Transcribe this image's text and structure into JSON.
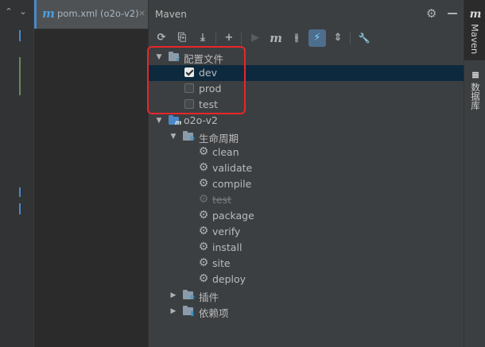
{
  "gutter": {
    "chevron_up": "⌃",
    "chevron_down": "⌄"
  },
  "editor": {
    "tab": {
      "label": "pom.xml (o2o-v2)",
      "icon": "maven-file-icon",
      "close": "×"
    }
  },
  "panel": {
    "title": "Maven"
  },
  "toolbar": [
    {
      "name": "reload-icon",
      "glyph": "⟳"
    },
    {
      "name": "folder-generate-icon",
      "glyph": "⎘"
    },
    {
      "name": "download-icon",
      "glyph": "⤓"
    },
    {
      "name": "add-icon",
      "glyph": "+"
    },
    {
      "name": "run-icon",
      "glyph": "▶"
    },
    {
      "name": "maven-goal-icon",
      "glyph": "m"
    },
    {
      "name": "toggle-offline-icon",
      "glyph": "⫲"
    },
    {
      "name": "skip-tests-icon",
      "glyph": "⚡"
    },
    {
      "name": "collapse-all-icon",
      "glyph": "⇕"
    },
    {
      "name": "settings-wrench-icon",
      "glyph": "🔧"
    }
  ],
  "tree": {
    "profiles": {
      "label": "配置文件",
      "items": [
        {
          "label": "dev",
          "checked": true
        },
        {
          "label": "prod",
          "checked": false
        },
        {
          "label": "test",
          "checked": false
        }
      ]
    },
    "project": {
      "label": "o2o-v2",
      "lifecycle": {
        "label": "生命周期",
        "goals": [
          {
            "label": "clean",
            "skipped": false
          },
          {
            "label": "validate",
            "skipped": false
          },
          {
            "label": "compile",
            "skipped": false
          },
          {
            "label": "test",
            "skipped": true
          },
          {
            "label": "package",
            "skipped": false
          },
          {
            "label": "verify",
            "skipped": false
          },
          {
            "label": "install",
            "skipped": false
          },
          {
            "label": "site",
            "skipped": false
          },
          {
            "label": "deploy",
            "skipped": false
          }
        ]
      },
      "plugins": {
        "label": "插件"
      },
      "dependencies": {
        "label": "依赖项"
      }
    }
  },
  "right_strip": {
    "maven_tab": {
      "icon": "m",
      "label": "Maven"
    },
    "database_tab": {
      "label": "数据库"
    }
  }
}
